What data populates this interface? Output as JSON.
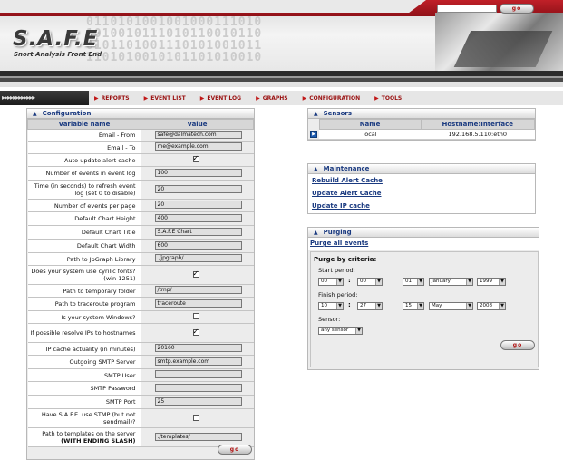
{
  "header": {
    "logo": "S.A.F.E",
    "subtitle": "Snort Analysis Front End",
    "go_label": "go"
  },
  "nav": {
    "arrows": "▸▸▸▸▸▸▸▸▸▸▸▸",
    "items": [
      {
        "label": "REPORTS"
      },
      {
        "label": "EVENT LIST"
      },
      {
        "label": "EVENT LOG"
      },
      {
        "label": "GRAPHS"
      },
      {
        "label": "CONFIGURATION"
      },
      {
        "label": "TOOLS"
      }
    ]
  },
  "config": {
    "title": "Configuration",
    "col_name": "Variable name",
    "col_value": "Value",
    "rows": [
      {
        "label": "Email - From",
        "value": "safe@dalmatech.com"
      },
      {
        "label": "Email - To",
        "value": "me@example.com"
      },
      {
        "label": "Auto update alert cache",
        "checked": true
      },
      {
        "label": "Number of events in event log",
        "value": "100"
      },
      {
        "label": "Time (in seconds) to refresh event log (set 0 to disable)",
        "value": "20"
      },
      {
        "label": "Number of events per page",
        "value": "20"
      },
      {
        "label": "Default Chart Height",
        "value": "400"
      },
      {
        "label": "Default Chart Title",
        "value": "S.A.F.E Chart"
      },
      {
        "label": "Default Chart Width",
        "value": "600"
      },
      {
        "label": "Path to JpGraph Library",
        "value": "./jpgraph/"
      },
      {
        "label": "Does your system use cyrilic fonts? (win-1251)",
        "checked": true
      },
      {
        "label": "Path to temporary folder",
        "value": "/tmp/"
      },
      {
        "label": "Path to traceroute program",
        "value": "traceroute"
      },
      {
        "label": "Is your system Windows?",
        "checked": false
      },
      {
        "label": "If possible resolve IPs to hostnames",
        "checked": true
      },
      {
        "label": "IP cache actuality (in minutes)",
        "value": "20160"
      },
      {
        "label": "Outgoing SMTP Server",
        "value": "smtp.example.com"
      },
      {
        "label": "SMTP User",
        "value": ""
      },
      {
        "label": "SMTP Password",
        "value": ""
      },
      {
        "label": "SMTP Port",
        "value": "25"
      },
      {
        "label": "Have S.A.F.E. use STMP (but not sendmail)?",
        "checked": false
      },
      {
        "label": "Path to templates on the server",
        "label_bold": "(WITH ENDING SLASH)",
        "value": "./templates/"
      }
    ]
  },
  "sensors": {
    "title": "Sensors",
    "col_name": "Name",
    "col_host": "Hostname:Interface",
    "rows": [
      {
        "name": "local",
        "host": "192.168.5.110:eth0"
      }
    ]
  },
  "maintenance": {
    "title": "Maintenance",
    "links": [
      "Rebuild Alert Cache",
      "Update Alert Cache",
      "Update IP cache"
    ]
  },
  "purging": {
    "title": "Purging",
    "purge_all": "Purge all events",
    "criteria_title": "Purge by criteria:",
    "start_label": "Start period:",
    "finish_label": "Finish period:",
    "sensor_label": "Sensor:",
    "start": {
      "hour": "00",
      "minute": "00",
      "day": "01",
      "month": "January",
      "year": "1999"
    },
    "finish": {
      "hour": "10",
      "minute": "27",
      "day": "15",
      "month": "May",
      "year": "2008"
    },
    "sensor": "any sensor",
    "colon": ":"
  }
}
